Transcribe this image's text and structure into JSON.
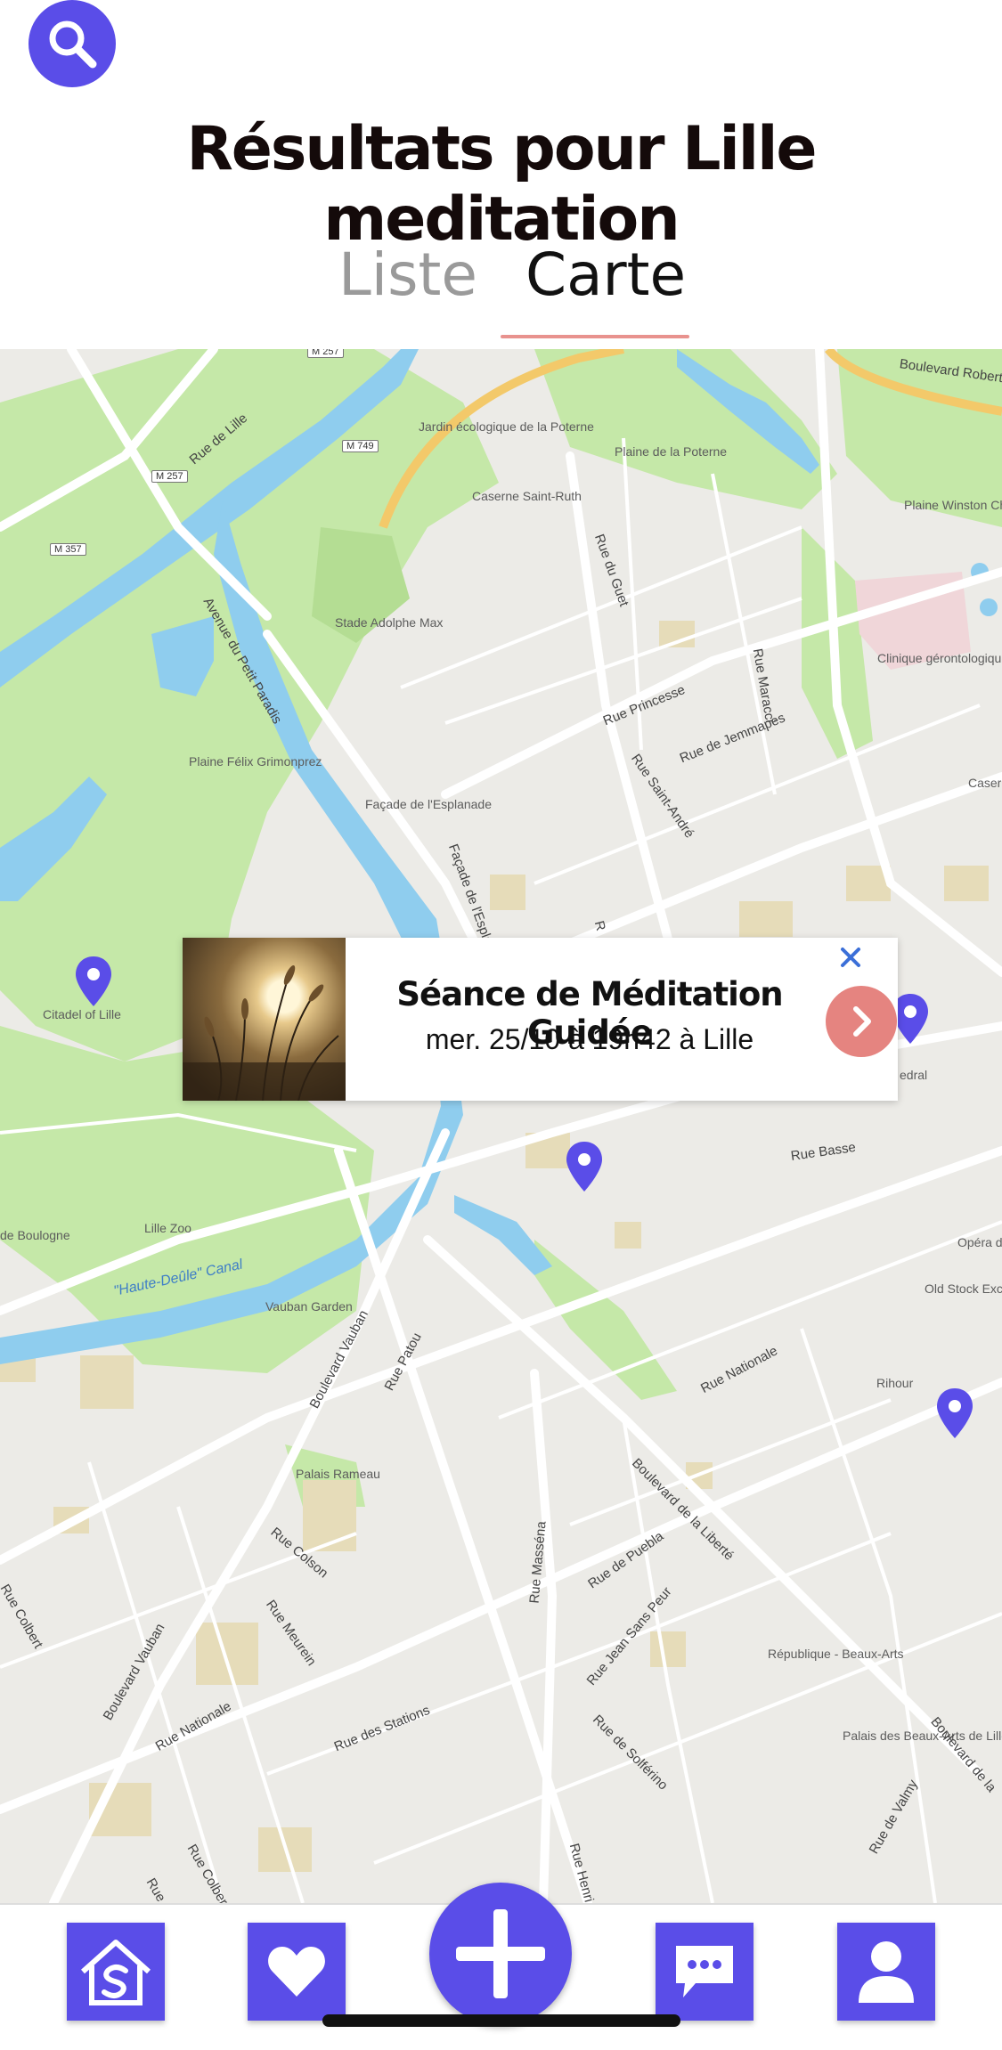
{
  "header": {
    "search_icon": "search-icon",
    "title": "Résultats pour Lille meditation"
  },
  "tabs": [
    {
      "label": "Liste",
      "active": false
    },
    {
      "label": "Carte",
      "active": true
    }
  ],
  "map": {
    "places": [
      "Jardin écologique de la Poterne",
      "Plaine de la Poterne",
      "Caserne Saint-Ruth",
      "Plaine Winston Churchill",
      "Stade Adolphe Max",
      "Clinique gérontologique Les Bateliers",
      "Plaine Félix Grimonprez",
      "Façade de l'Esplanade",
      "Caserne",
      "Citadel of Lille",
      "Lille Zoo",
      "Vauban Garden",
      "de Boulogne",
      "Opéra de",
      "Old Stock Exchange",
      "Rihour",
      "Palais Rameau",
      "République - Beaux-Arts",
      "Palais des Beaux-Arts de Lille",
      "edral"
    ],
    "roads": [
      "Rue de Lille",
      "Avenue du Petit Paradis",
      "Rue du Guet",
      "Rue Princesse",
      "Rue Saint-André",
      "Rue de Jemmapes",
      "Rue Maracci",
      "Façade de l'Esplan",
      "Boulevard Robert S",
      "Rue Basse",
      "Rue Nationale",
      "Boulevard Vauban",
      "Rue Patou",
      "Boulevard de la Liberté",
      "Rue Colson",
      "Rue Meurein",
      "Rue Colbert",
      "Rue de Puebla",
      "Rue Masséna",
      "Rue Jean Sans Peur",
      "Rue des Stations",
      "Rue de Solférino",
      "Rue Henri Kolb",
      "Rue de Valmy",
      "Boulevard de la",
      "Rue Nationale",
      "Boulevard Vauban",
      "Rue Colbert",
      "Rue d'A",
      "R"
    ],
    "shields": [
      "M 257",
      "M 749",
      "M 257",
      "M 357"
    ],
    "canal_label": "\"Haute-Deûle\" Canal",
    "marker_color": "#5a4de8"
  },
  "event_card": {
    "title": "Séance de Méditation Guidée",
    "date": "mer. 25/10 à 19h42 à Lille",
    "close_icon": "close-icon",
    "go_icon": "chevron-right-icon"
  },
  "bottom_nav": {
    "accent": "#5a4de8",
    "items": [
      "home-icon",
      "heart-icon",
      "plus-icon",
      "chat-icon",
      "user-icon"
    ]
  }
}
